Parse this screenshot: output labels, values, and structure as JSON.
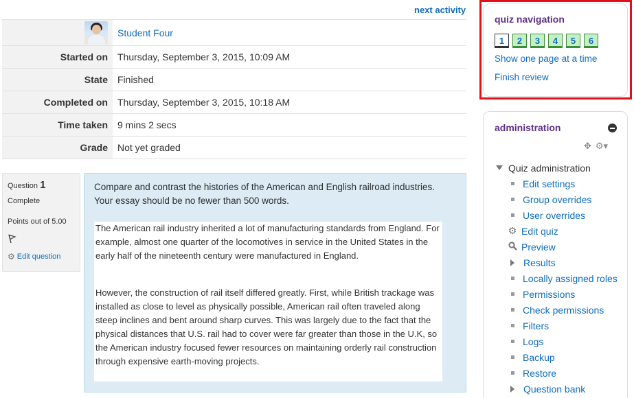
{
  "header": {
    "next_activity": "next activity"
  },
  "summary": {
    "student_name": "Student Four",
    "rows": [
      {
        "label": "Started on",
        "value": "Thursday, September 3, 2015, 10:09 AM"
      },
      {
        "label": "State",
        "value": "Finished"
      },
      {
        "label": "Completed on",
        "value": "Thursday, September 3, 2015, 10:18 AM"
      },
      {
        "label": "Time taken",
        "value": "9 mins 2 secs"
      },
      {
        "label": "Grade",
        "value": "Not yet graded"
      }
    ]
  },
  "question": {
    "label": "Question",
    "number": "1",
    "status": "Complete",
    "points": "Points out of 5.00",
    "edit_label": "Edit question",
    "prompt": "Compare and contrast the histories of the American and English railroad industries.  Your essay should be no fewer than 500 words.",
    "answer": [
      "The American rail industry inherited a lot of manufacturing standards from England.  For example, almost one quarter of the locomotives in service in the United States in the early half of the nineteenth century were manufactured in England.",
      "However, the construction of rail itself differed greatly.  First, while British trackage was installed as close to level as physically possible, American rail often traveled along steep inclines and bent around sharp curves.  This was largely due to the fact that the physical distances that U.S. rail had to cover were far greater than those in the U.K, so the American industry focused fewer resources on maintaining orderly rail construction through expensive earth-moving projects."
    ]
  },
  "quiz_navigation": {
    "title": "quiz navigation",
    "buttons": [
      "1",
      "2",
      "3",
      "4",
      "5",
      "6"
    ],
    "show_one_page": "Show one page at a time",
    "finish_review": "Finish review"
  },
  "administration": {
    "title": "administration",
    "root": "Quiz administration",
    "items": [
      {
        "label": "Edit settings",
        "icon": "bullet"
      },
      {
        "label": "Group overrides",
        "icon": "bullet"
      },
      {
        "label": "User overrides",
        "icon": "bullet"
      },
      {
        "label": "Edit quiz",
        "icon": "gear-icon"
      },
      {
        "label": "Preview",
        "icon": "search-icon"
      },
      {
        "label": "Results",
        "icon": "caret-right"
      },
      {
        "label": "Locally assigned roles",
        "icon": "bullet"
      },
      {
        "label": "Permissions",
        "icon": "bullet"
      },
      {
        "label": "Check permissions",
        "icon": "bullet"
      },
      {
        "label": "Filters",
        "icon": "bullet"
      },
      {
        "label": "Logs",
        "icon": "bullet"
      },
      {
        "label": "Backup",
        "icon": "bullet"
      },
      {
        "label": "Restore",
        "icon": "bullet"
      },
      {
        "label": "Question bank",
        "icon": "caret-right"
      }
    ]
  },
  "colors": {
    "link": "#0f6cbf",
    "block_title": "#5d2f86",
    "highlight": "#e0101a",
    "answered_button": "#c5f0c5",
    "question_bg": "#dcebf4"
  }
}
